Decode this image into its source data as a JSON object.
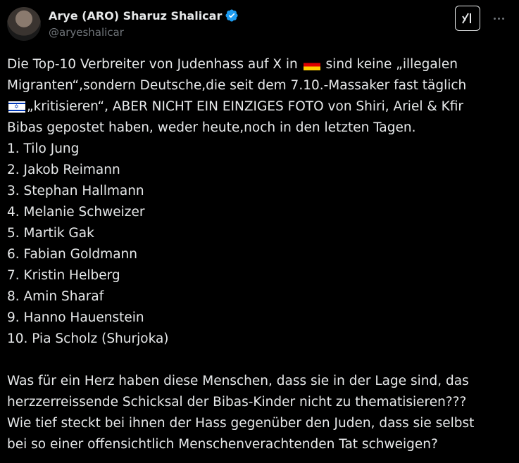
{
  "author": {
    "name": "Arye (ARO) Sharuz Shalicar",
    "handle": "@aryeshalicar"
  },
  "colors": {
    "background": "#000000",
    "text": "#e7e9ea",
    "muted": "#71767b",
    "verified": "#1d9bf0"
  },
  "icons": {
    "verified": "verified-badge-icon",
    "grok": "grok-icon",
    "more": "more-icon"
  },
  "tweet": {
    "line1_a": "Die Top-10 Verbreiter von Judenhass auf X in",
    "line1_b": "sind keine „illegalen",
    "line2": "Migranten“,sondern Deutsche,die seit dem 7.10.-Massaker fast täglich",
    "line3": "„kritisieren“, ABER NICHT EIN EINZIGES FOTO von Shiri, Ariel & Kfir",
    "line4": "Bibas gepostet haben, weder heute,noch in den letzten Tagen.",
    "list": [
      "1. Tilo Jung",
      "2. Jakob Reimann",
      "3. Stephan Hallmann",
      "4. Melanie Schweizer",
      "5. Martik Gak",
      "6. Fabian Goldmann",
      "7. Kristin Helberg",
      "8. Amin Sharaf",
      "9. Hanno Hauenstein",
      "10. Pia Scholz (Shurjoka)"
    ],
    "closing": [
      "Was für ein Herz haben diese Menschen, dass sie in der Lage sind, das",
      "herzzerreissende Schicksal der Bibas-Kinder nicht zu thematisieren???",
      "Wie tief steckt bei ihnen der Hass gegenüber den Juden, dass sie selbst",
      "bei so einer offensichtlich Menschenverachtenden Tat schweigen?"
    ]
  }
}
